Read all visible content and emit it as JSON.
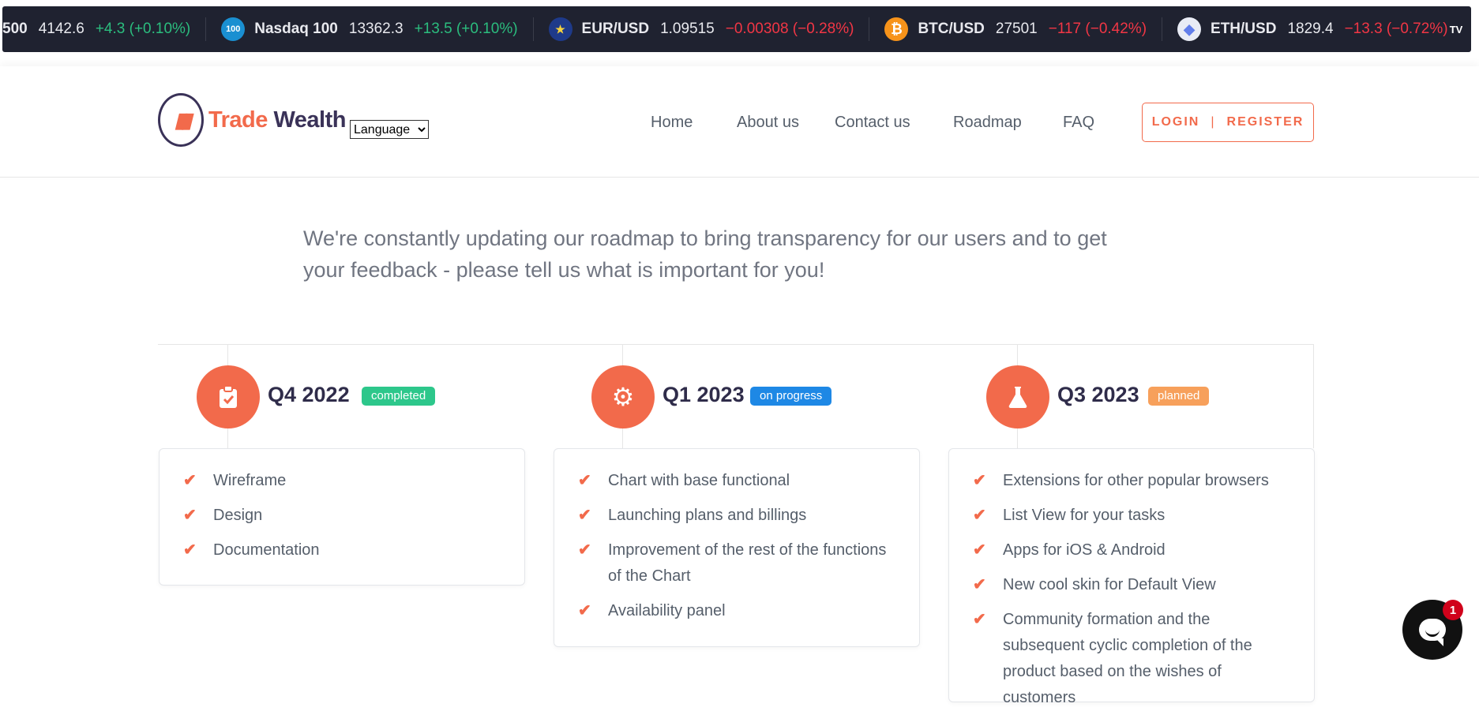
{
  "ticker": {
    "items": [
      {
        "symbol": "500",
        "price": "4142.6",
        "change": "+4.3 (+0.10%)",
        "direction": "up",
        "icon": ""
      },
      {
        "symbol": "Nasdaq 100",
        "price": "13362.3",
        "change": "+13.5 (+0.10%)",
        "direction": "up",
        "icon": "100"
      },
      {
        "symbol": "EUR/USD",
        "price": "1.09515",
        "change": "−0.00308 (−0.28%)",
        "direction": "down",
        "icon": "eur-usd-flag-icon"
      },
      {
        "symbol": "BTC/USD",
        "price": "27501",
        "change": "−117 (−0.42%)",
        "direction": "down",
        "icon": "bitcoin-icon"
      },
      {
        "symbol": "ETH/USD",
        "price": "1829.4",
        "change": "−13.3 (−0.72%)",
        "direction": "down",
        "icon": "ethereum-icon"
      }
    ],
    "brand_icon": "tradingview-icon",
    "colors": {
      "up": "#2bbd7e",
      "down": "#f23645",
      "background": "#1f2230"
    }
  },
  "header": {
    "logo": {
      "word1": "Trade",
      "word2": "Wealth"
    },
    "language_select": {
      "selected": "Language"
    },
    "nav": {
      "home": "Home",
      "about": "About us",
      "contact": "Contact us",
      "roadmap": "Roadmap",
      "faq": "FAQ"
    },
    "auth": {
      "login": "LOGIN",
      "separator": "|",
      "register": "REGISTER"
    },
    "accent_color": "#f26a4b"
  },
  "intro": {
    "text": "We're constantly updating our roadmap to bring transparency for our users and to get your feedback - please tell us what is important for you!"
  },
  "roadmap": {
    "columns": [
      {
        "quarter": "Q4 2022",
        "status": "completed",
        "icon": "clipboard-check-icon",
        "items": [
          "Wireframe",
          "Design",
          "Documentation"
        ]
      },
      {
        "quarter": "Q1 2023",
        "status": "on progress",
        "icon": "gear-icon",
        "items": [
          "Chart with base functional",
          "Launching plans and billings",
          "Improvement of the rest of the functions of the Chart",
          "Availability panel"
        ]
      },
      {
        "quarter": "Q3 2023",
        "status": "planned",
        "icon": "flask-icon",
        "items": [
          "Extensions for other popular browsers",
          "List View for your tasks",
          "Apps for iOS & Android",
          "New cool skin for Default View",
          "Community formation and the subsequent cyclic completion of the product based on the wishes of customers"
        ]
      }
    ],
    "status_colors": {
      "completed": "#2dc78b",
      "on progress": "#1e88e5",
      "planned": "#f7a05b"
    }
  },
  "chat_widget": {
    "unread_count": "1",
    "icon": "chat-icon"
  }
}
